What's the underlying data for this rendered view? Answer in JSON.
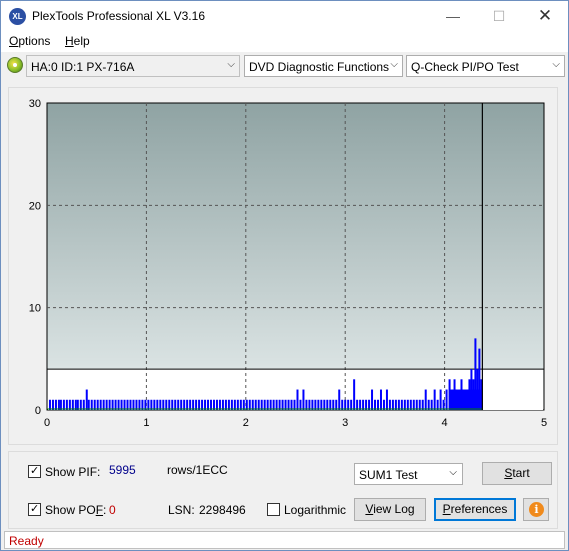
{
  "window": {
    "title": "PlexTools Professional XL V3.16",
    "logo_text": "XL",
    "minimize_icon": "—",
    "maximize_icon": "☐",
    "close_icon": "✕"
  },
  "menu": {
    "options_label_u": "O",
    "options_label_rest": "ptions",
    "help_label_u": "H",
    "help_label_rest": "elp"
  },
  "toolbar": {
    "drive": "HA:0 ID:1  PX-716A",
    "function": "DVD Diagnostic Functions",
    "test": "Q-Check PI/PO Test",
    "dropdown_arrow": "⌵"
  },
  "chart_data": {
    "type": "bar",
    "x_ticks": [
      "0",
      "1",
      "2",
      "3",
      "4",
      "5"
    ],
    "y_ticks": [
      "0",
      "10",
      "20",
      "30"
    ],
    "xlim": [
      0,
      5
    ],
    "ylim": [
      0,
      30
    ],
    "threshold_line": 4,
    "end_marker_x": 4.38,
    "grid": true,
    "colors": {
      "plot_bg_top": "#8fa3a3",
      "plot_bg_bottom": "#ffffff",
      "bars": "#0000ff",
      "baseline": "#008000",
      "grid": "#555555"
    },
    "series": [
      {
        "values": [
          [
            0.03,
            1
          ],
          [
            0.06,
            1
          ],
          [
            0.09,
            1
          ],
          [
            0.12,
            1
          ],
          [
            0.14,
            1
          ],
          [
            0.17,
            1
          ],
          [
            0.2,
            1
          ],
          [
            0.23,
            1
          ],
          [
            0.26,
            1
          ],
          [
            0.29,
            1
          ],
          [
            0.31,
            1
          ],
          [
            0.34,
            1
          ],
          [
            0.37,
            1
          ],
          [
            0.4,
            2
          ],
          [
            0.42,
            1
          ],
          [
            0.45,
            1
          ],
          [
            0.48,
            1
          ],
          [
            0.51,
            1
          ],
          [
            0.54,
            1
          ],
          [
            0.57,
            1
          ],
          [
            0.6,
            1
          ],
          [
            0.63,
            1
          ],
          [
            0.66,
            1
          ],
          [
            0.69,
            1
          ],
          [
            0.72,
            1
          ],
          [
            0.75,
            1
          ],
          [
            0.78,
            1
          ],
          [
            0.81,
            1
          ],
          [
            0.84,
            1
          ],
          [
            0.87,
            1
          ],
          [
            0.9,
            1
          ],
          [
            0.93,
            1
          ],
          [
            0.96,
            1
          ],
          [
            0.99,
            1
          ],
          [
            1.02,
            1
          ],
          [
            1.05,
            1
          ],
          [
            1.08,
            1
          ],
          [
            1.11,
            1
          ],
          [
            1.14,
            1
          ],
          [
            1.17,
            1
          ],
          [
            1.2,
            1
          ],
          [
            1.23,
            1
          ],
          [
            1.26,
            1
          ],
          [
            1.29,
            1
          ],
          [
            1.32,
            1
          ],
          [
            1.35,
            1
          ],
          [
            1.38,
            1
          ],
          [
            1.41,
            1
          ],
          [
            1.44,
            1
          ],
          [
            1.47,
            1
          ],
          [
            1.5,
            1
          ],
          [
            1.53,
            1
          ],
          [
            1.56,
            1
          ],
          [
            1.59,
            1
          ],
          [
            1.62,
            1
          ],
          [
            1.65,
            1
          ],
          [
            1.68,
            1
          ],
          [
            1.71,
            1
          ],
          [
            1.74,
            1
          ],
          [
            1.77,
            1
          ],
          [
            1.8,
            1
          ],
          [
            1.83,
            1
          ],
          [
            1.86,
            1
          ],
          [
            1.89,
            1
          ],
          [
            1.92,
            1
          ],
          [
            1.95,
            1
          ],
          [
            1.98,
            1
          ],
          [
            2.01,
            1
          ],
          [
            2.04,
            1
          ],
          [
            2.07,
            1
          ],
          [
            2.1,
            1
          ],
          [
            2.13,
            1
          ],
          [
            2.16,
            1
          ],
          [
            2.19,
            1
          ],
          [
            2.22,
            1
          ],
          [
            2.25,
            1
          ],
          [
            2.28,
            1
          ],
          [
            2.31,
            1
          ],
          [
            2.34,
            1
          ],
          [
            2.37,
            1
          ],
          [
            2.4,
            1
          ],
          [
            2.43,
            1
          ],
          [
            2.46,
            1
          ],
          [
            2.49,
            1
          ],
          [
            2.52,
            2
          ],
          [
            2.55,
            1
          ],
          [
            2.58,
            2
          ],
          [
            2.61,
            1
          ],
          [
            2.64,
            1
          ],
          [
            2.67,
            1
          ],
          [
            2.7,
            1
          ],
          [
            2.73,
            1
          ],
          [
            2.76,
            1
          ],
          [
            2.79,
            1
          ],
          [
            2.82,
            1
          ],
          [
            2.85,
            1
          ],
          [
            2.88,
            1
          ],
          [
            2.91,
            1
          ],
          [
            2.94,
            2
          ],
          [
            2.97,
            1
          ],
          [
            3.0,
            1
          ],
          [
            3.03,
            1
          ],
          [
            3.06,
            1
          ],
          [
            3.09,
            3
          ],
          [
            3.12,
            1
          ],
          [
            3.15,
            1
          ],
          [
            3.18,
            1
          ],
          [
            3.21,
            1
          ],
          [
            3.24,
            1
          ],
          [
            3.27,
            2
          ],
          [
            3.3,
            1
          ],
          [
            3.33,
            1
          ],
          [
            3.36,
            2
          ],
          [
            3.39,
            1
          ],
          [
            3.42,
            2
          ],
          [
            3.45,
            1
          ],
          [
            3.48,
            1
          ],
          [
            3.51,
            1
          ],
          [
            3.54,
            1
          ],
          [
            3.57,
            1
          ],
          [
            3.6,
            1
          ],
          [
            3.63,
            1
          ],
          [
            3.66,
            1
          ],
          [
            3.69,
            1
          ],
          [
            3.72,
            1
          ],
          [
            3.75,
            1
          ],
          [
            3.78,
            1
          ],
          [
            3.81,
            2
          ],
          [
            3.84,
            1
          ],
          [
            3.87,
            1
          ],
          [
            3.9,
            2
          ],
          [
            3.93,
            1
          ],
          [
            3.96,
            2
          ],
          [
            3.99,
            1
          ],
          [
            4.02,
            2
          ],
          [
            4.05,
            3
          ],
          [
            4.08,
            2
          ],
          [
            4.1,
            3
          ],
          [
            4.12,
            2
          ],
          [
            4.15,
            2
          ],
          [
            4.17,
            3
          ],
          [
            4.19,
            2
          ],
          [
            4.21,
            2
          ],
          [
            4.23,
            2
          ],
          [
            4.25,
            3
          ],
          [
            4.27,
            4
          ],
          [
            4.29,
            3
          ],
          [
            4.31,
            7
          ],
          [
            4.33,
            4
          ],
          [
            4.35,
            6
          ],
          [
            4.37,
            3
          ]
        ]
      }
    ]
  },
  "controls": {
    "show_pif_label": "Show PIF:",
    "pif_value": "5995",
    "pif_unit": "rows/1ECC",
    "show_pof_label_pre": "Show PO",
    "show_pof_label_u": "F",
    "show_pof_label_post": ":",
    "pof_value": "0",
    "lsn_label": "LSN:",
    "lsn_value": "2298496",
    "logarithmic_label": "Logarithmic",
    "test_select": "SUM1 Test",
    "start_u": "S",
    "start_rest": "tart",
    "viewlog_pre": "",
    "viewlog_u": "V",
    "viewlog_rest": "iew Log",
    "prefs_pre": "",
    "prefs_u": "P",
    "prefs_rest": "references",
    "info_glyph": "i"
  },
  "status": {
    "text": "Ready"
  }
}
